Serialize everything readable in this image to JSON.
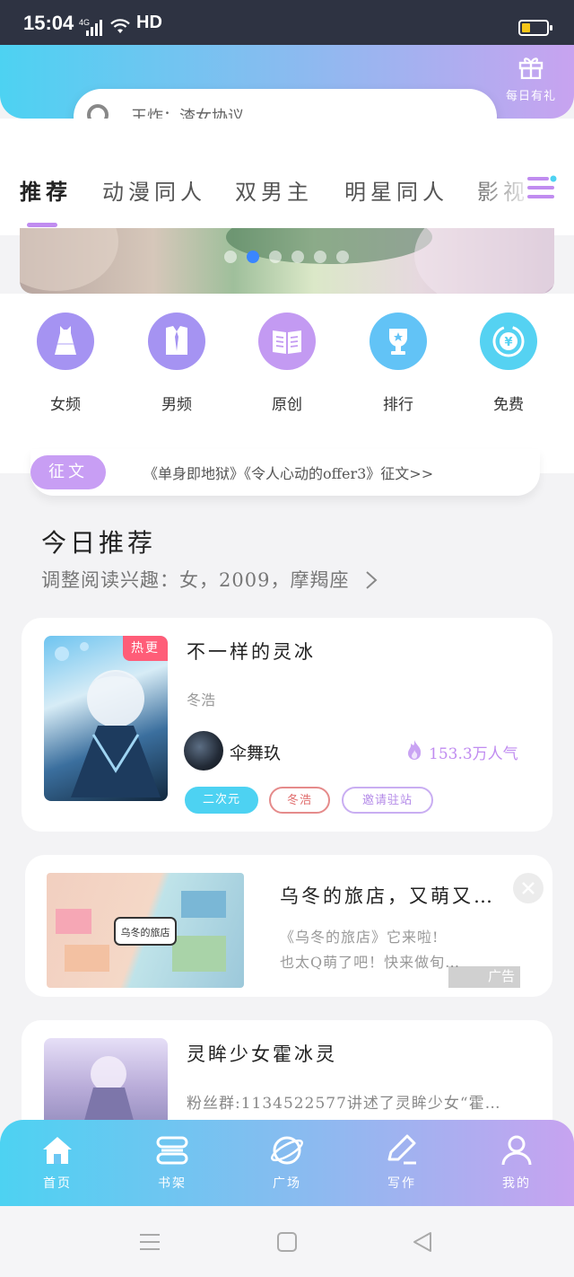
{
  "status_bar": {
    "time": "15:04",
    "network": "4G",
    "hd": "HD"
  },
  "header": {
    "gift_label": "每日有礼",
    "search_placeholder": "王炸：渣女协议"
  },
  "tabs": [
    "推荐",
    "动漫同人",
    "双男主",
    "明星同人",
    "影视"
  ],
  "active_tab_index": 0,
  "banner": {
    "dot_count": 6,
    "active_dot": 1
  },
  "categories": [
    {
      "label": "女频",
      "icon": "dress-icon",
      "color": "#a593f2"
    },
    {
      "label": "男频",
      "icon": "shirt-icon",
      "color": "#a593f2"
    },
    {
      "label": "原创",
      "icon": "book-icon",
      "color": "#c39af2"
    },
    {
      "label": "排行",
      "icon": "trophy-icon",
      "color": "#62c3f6"
    },
    {
      "label": "免费",
      "icon": "yuan-coin-icon",
      "color": "#55d2f2"
    }
  ],
  "notice": {
    "badge": "征文",
    "text": "《单身即地狱》《令人心动的offer3》征文>>"
  },
  "section": {
    "title": "今日推荐",
    "subtitle": "调整阅读兴趣：女，2009，摩羯座"
  },
  "books": [
    {
      "title": "不一样的灵冰",
      "badge": "热更",
      "author": "冬浩",
      "username": "伞舞玖",
      "popularity": "153.3万人气",
      "tags": [
        "二次元",
        "冬浩",
        "邀请驻站"
      ]
    },
    {
      "title": "灵眸少女霍冰灵",
      "desc": "粉丝群:1134522577讲述了灵眸少女“霍…"
    }
  ],
  "ad": {
    "title": "乌冬的旅店，又萌又…",
    "desc_line1": "《乌冬的旅店》它来啦!",
    "desc_line2": "也太Q萌了吧！快来做旬…",
    "tag": "广告",
    "image_text": "乌冬的旅店"
  },
  "bottom_nav": [
    {
      "label": "首页",
      "icon": "home-icon"
    },
    {
      "label": "书架",
      "icon": "bookshelf-icon"
    },
    {
      "label": "广场",
      "icon": "planet-icon"
    },
    {
      "label": "写作",
      "icon": "write-icon"
    },
    {
      "label": "我的",
      "icon": "user-icon"
    }
  ],
  "colors": {
    "accent_purple": "#c08cf0",
    "accent_cyan": "#4dd2f2",
    "hot_red": "#ff5d78"
  }
}
